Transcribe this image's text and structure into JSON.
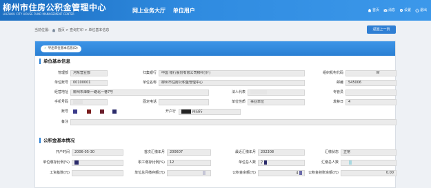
{
  "header": {
    "logo_title": "柳州市住房公积金管理中心",
    "logo_subtitle": "LIUZHOU CITY HOUSE FUND MANAGEMENT CENTER",
    "nav_hall": "网上业务大厅",
    "nav_unit": "单位用户",
    "links": {
      "home": "首页",
      "message": "消息",
      "settings": "设置",
      "logout": "退出"
    }
  },
  "breadcrumb": {
    "label": "当前位置:",
    "path": "首页 > 查询打印 > 单位基本信息"
  },
  "back_button": "返回上一页",
  "export_button": "导出单位基本信息(D)",
  "unit_section": {
    "title": "单位基本信息",
    "fields": {
      "dept_label": "管理部",
      "dept_value": "河东营业部",
      "bank_label": "归集银行",
      "bank_value": "中国    银行股份有限公司柳州分行",
      "org_code_label": "组织机构代码",
      "org_code_value": "W",
      "acct_label": "单位账号",
      "acct_value": "00100001",
      "name_label": "单位名称",
      "name_value": "柳州市住房公积金管理中心",
      "postcode_label": "邮编",
      "postcode_value": "545006",
      "addr_label": "经营地址",
      "addr_value": "柳州市潭新一路北一巷7号",
      "legal_label": "法人代表",
      "legal_value": "",
      "manager_label": "专管员",
      "manager_value": "",
      "mobile_label": "手机号码",
      "mobile_value": "",
      "phone_label": "固定电话",
      "phone_value": "",
      "nature_label": "单位性质",
      "nature_value": "事业单位",
      "payday_label": "发薪日",
      "payday_value": "4",
      "account_label": "账号",
      "account_value": "",
      "openbank_label": "开户行",
      "openbank_value": "州分行",
      "remark_label": "备注",
      "remark_value": ""
    }
  },
  "fund_section": {
    "title": "公积金基本情况",
    "fields": {
      "open_label": "开户时间",
      "open_value": "2006-05-30",
      "first_label": "首次汇缴年月",
      "first_value": "200607",
      "last_label": "最近汇缴年月",
      "last_value": "202308",
      "status_label": "汇缴状态",
      "status_value": "正常",
      "unit_ratio_label": "单位缴存比例(%)",
      "unit_ratio_value": "",
      "emp_ratio_label": "职工缴存比例(%)",
      "emp_ratio_value": "12",
      "total_label": "单位总人数",
      "total_value": "7",
      "paying_label": "汇缴总人数",
      "paying_value": "",
      "wage_label": "工资基数(元)",
      "wage_value": "",
      "monthly_label": "单位总月缴存额(元)",
      "monthly_value": "",
      "balance_label": "公积金余额(元)",
      "balance_value": "4",
      "pending_label": "公积金挂账余额(元)",
      "pending_value": "0.00"
    }
  },
  "colors": {
    "header": "#2f8be0",
    "accent": "#2a7fd3",
    "field_bg": "#ebebeb"
  }
}
